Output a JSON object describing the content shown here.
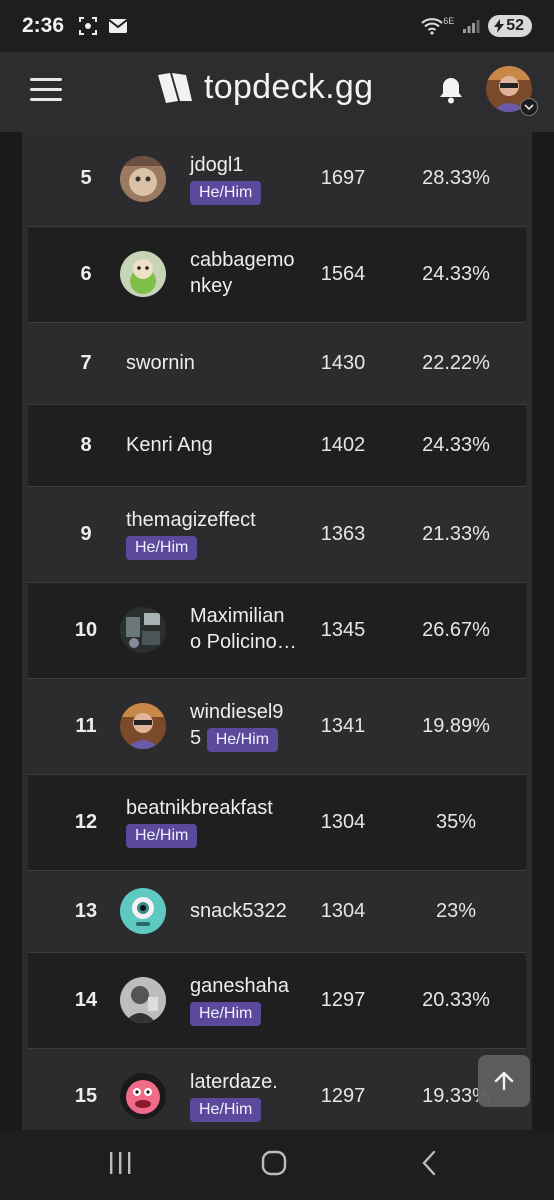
{
  "status": {
    "time": "2:36",
    "network_label": "6E",
    "battery": "52"
  },
  "header": {
    "logo_text": "topdeck.gg"
  },
  "leaderboard": [
    {
      "rank": "5",
      "name_line1": "jdogl1",
      "name_line2": "",
      "badge": "He/Him",
      "elo": "1697",
      "pct": "28.33%",
      "avatar": "cat"
    },
    {
      "rank": "6",
      "name_line1": "cabbagemo",
      "name_line2": "nkey",
      "badge": "",
      "elo": "1564",
      "pct": "24.33%",
      "avatar": "cabbage"
    },
    {
      "rank": "7",
      "name_line1": "swornin",
      "name_line2": "",
      "badge": "",
      "elo": "1430",
      "pct": "22.22%",
      "avatar": ""
    },
    {
      "rank": "8",
      "name_line1": "Kenri Ang",
      "name_line2": "",
      "badge": "",
      "elo": "1402",
      "pct": "24.33%",
      "avatar": ""
    },
    {
      "rank": "9",
      "name_line1": "themagizeffect",
      "name_line2": "",
      "badge": "He/Him",
      "elo": "1363",
      "pct": "21.33%",
      "avatar": ""
    },
    {
      "rank": "10",
      "name_line1": "Maximilian",
      "name_line2": "o Policino…",
      "badge": "",
      "elo": "1345",
      "pct": "26.67%",
      "avatar": "room"
    },
    {
      "rank": "11",
      "name_line1": "windiesel9",
      "name_line2": "5",
      "badge": "He/Him",
      "elo": "1341",
      "pct": "19.89%",
      "avatar": "person"
    },
    {
      "rank": "12",
      "name_line1": "beatnikbreakfast",
      "name_line2": "",
      "badge": "He/Him",
      "elo": "1304",
      "pct": "35%",
      "avatar": ""
    },
    {
      "rank": "13",
      "name_line1": "snack5322",
      "name_line2": "",
      "badge": "",
      "elo": "1304",
      "pct": "23%",
      "avatar": "eye"
    },
    {
      "rank": "14",
      "name_line1": "ganeshaha",
      "name_line2": "",
      "badge": "He/Him",
      "elo": "1297",
      "pct": "20.33%",
      "avatar": "bw"
    },
    {
      "rank": "15",
      "name_line1": "laterdaze.",
      "name_line2": "",
      "badge": "He/Him",
      "elo": "1297",
      "pct": "19.33%",
      "avatar": "star"
    }
  ],
  "colors": {
    "badge": "#5b4a9b",
    "row_dark": "#1f1f20",
    "row_light": "#2c2c2e",
    "header": "#2d2d30"
  }
}
